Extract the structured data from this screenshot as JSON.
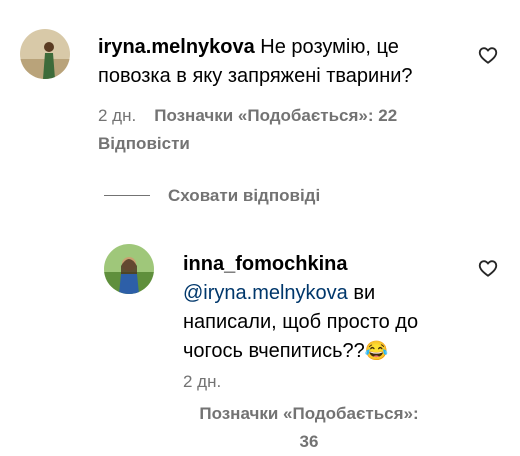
{
  "comment1": {
    "username": "iryna.melnykova",
    "text_line1": " Не розумію, це",
    "text_line2": "повозка в яку запряжені тварини?",
    "time": "2 дн.",
    "likes": "Позначки «Подобається»: 22",
    "reply": "Відповісти"
  },
  "thread": {
    "hide_replies": "Сховати відповіді"
  },
  "comment2": {
    "username": "inna_fomochkina",
    "mention": "@iryna.melnykova",
    "text_line1_rest": " ви",
    "text_line2": "написали, щоб просто до",
    "text_line3": "чогось вчепитись??",
    "emoji": "😂",
    "time": "2 дн.",
    "likes_label": "Позначки «Подобається»:",
    "likes_count": "36"
  },
  "icons": {
    "like": "heart-outline-icon"
  },
  "colors": {
    "text": "#000000",
    "secondary": "#737373",
    "mention": "#00376b"
  }
}
